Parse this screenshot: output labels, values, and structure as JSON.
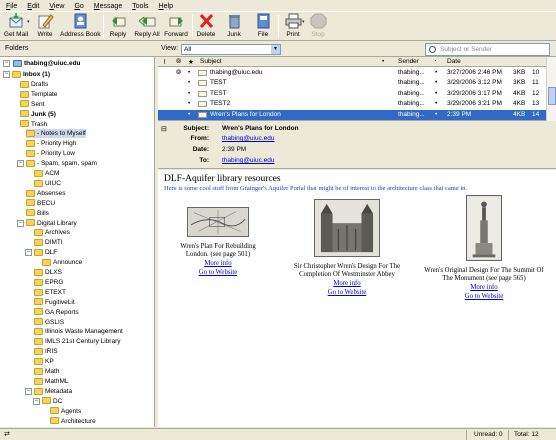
{
  "menu": [
    "File",
    "Edit",
    "View",
    "Go",
    "Message",
    "Tools",
    "Help"
  ],
  "toolbar": {
    "get_mail": "Get Mail",
    "write": "Write",
    "address_book": "Address Book",
    "reply": "Reply",
    "reply_all": "Reply All",
    "forward": "Forward",
    "delete": "Delete",
    "junk": "Junk",
    "file": "File",
    "print": "Print",
    "stop": "Stop"
  },
  "filter": {
    "folders_label": "Folders",
    "view_label": "View:",
    "view_value": "All",
    "search_placeholder": "Subject or Sender"
  },
  "folders": {
    "account": "thabing@uiuc.edu",
    "items": [
      {
        "label": "Inbox (1)",
        "bold": true
      },
      {
        "label": "Drafts"
      },
      {
        "label": "Template"
      },
      {
        "label": "Sent"
      },
      {
        "label": "Junk (5)",
        "bold": true
      },
      {
        "label": "Trash"
      },
      {
        "label": "- Notes to Myself"
      },
      {
        "label": "- Priority High"
      },
      {
        "label": "- Priority Low"
      },
      {
        "label": "- Spam, spam, spam"
      },
      {
        "label": "ACM"
      },
      {
        "label": "UIUC"
      },
      {
        "label": "Absenses"
      },
      {
        "label": "BECU"
      },
      {
        "label": "Bills"
      },
      {
        "label": "Digital Library"
      },
      {
        "label": "Archives"
      },
      {
        "label": "DIMTI"
      },
      {
        "label": "DLF"
      },
      {
        "label": "Announce"
      },
      {
        "label": "DLXS"
      },
      {
        "label": "EPRG"
      },
      {
        "label": "ETEXT"
      },
      {
        "label": "FugitiveLit"
      },
      {
        "label": "GA Reports"
      },
      {
        "label": "GSLIS"
      },
      {
        "label": "Illinois Waste Management"
      },
      {
        "label": "IMLS 21st Century Library"
      },
      {
        "label": "IRIS"
      },
      {
        "label": "KP"
      },
      {
        "label": "Math"
      },
      {
        "label": "MathML"
      },
      {
        "label": "Metadata"
      },
      {
        "label": "DC"
      },
      {
        "label": "Agents"
      },
      {
        "label": "Architecture"
      }
    ]
  },
  "message_list": {
    "columns": [
      "Subject",
      "Sender",
      "Date"
    ],
    "rows": [
      {
        "subject": "thabing@uiuc.edu",
        "sender": "thabing...",
        "date": "3/27/2006 2:46 PM",
        "size": "3KB",
        "count": "10"
      },
      {
        "subject": "TEST",
        "sender": "thabing...",
        "date": "3/29/2006 3:12 PM",
        "size": "3KB",
        "count": "11"
      },
      {
        "subject": "TEST",
        "sender": "thabing...",
        "date": "3/29/2006 3:17 PM",
        "size": "4KB",
        "count": "12"
      },
      {
        "subject": "TEST2",
        "sender": "thabing...",
        "date": "3/29/2006 3:21 PM",
        "size": "4KB",
        "count": "13"
      },
      {
        "subject": "Wren's Plans for London",
        "sender": "thabing...",
        "date": "2:39 PM",
        "size": "4KB",
        "count": "14"
      }
    ]
  },
  "headers": {
    "subject_label": "Subject:",
    "subject": "Wren's Plans for London",
    "from_label": "From:",
    "from": "thabing@uiuc.edu",
    "date_label": "Date:",
    "date": "2:39 PM",
    "to_label": "To:",
    "to": "thabing@uiuc.edu"
  },
  "body": {
    "title": "DLF-Aquifer library resources",
    "intro": "Here is some cool stuff from Grainger's Aquifer Portal that might be of interest to the architecture class that came in.",
    "items": [
      {
        "caption1": "Wren's Plan For Rebuilding",
        "caption2": "London. (see page 501)",
        "more": "More info",
        "website": "Go to Website"
      },
      {
        "caption1": "Sir Christopher Wren's Design For The",
        "caption2": "Completion Of Westminster Abbey",
        "more": "More info",
        "website": "Go to Website"
      },
      {
        "caption1": "Wren's Original Design For The Summit Of",
        "caption2": "The Monument (see page 565)",
        "more": "More info",
        "website": "Go to Website"
      }
    ]
  },
  "status": {
    "unread": "Unread: 0",
    "total": "Total: 12"
  }
}
